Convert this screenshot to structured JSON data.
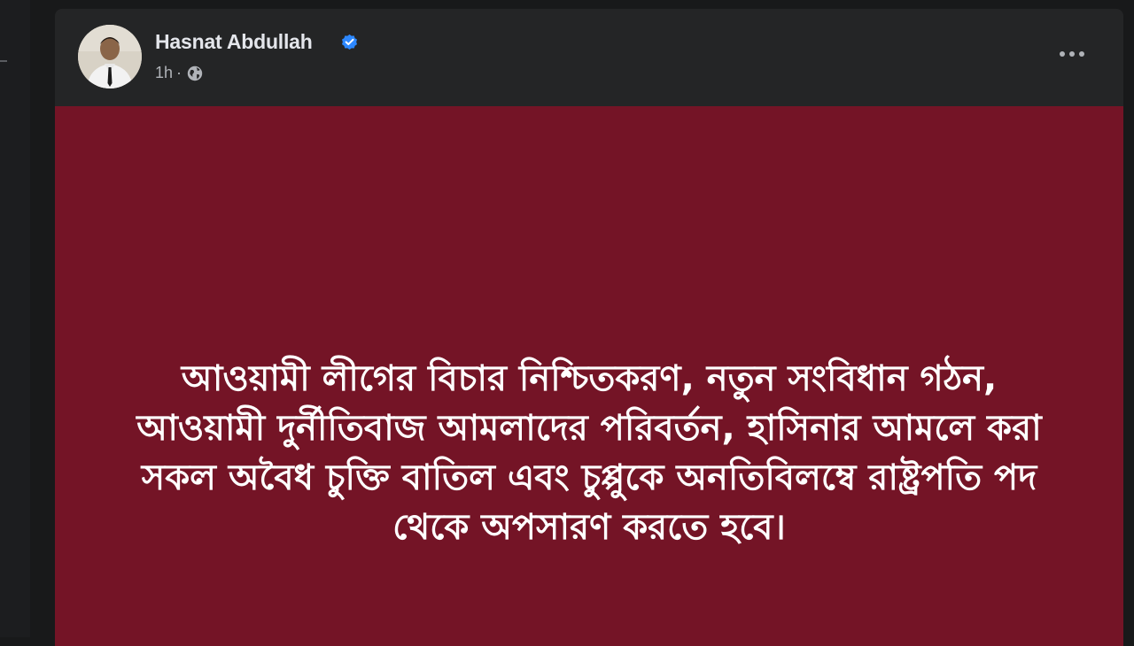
{
  "post": {
    "author_name": "Hasnat Abdullah",
    "timestamp": "1h",
    "separator": "·",
    "privacy_icon": "globe-icon",
    "verified_icon": "verified-badge-icon",
    "more_icon": "more-horizontal-icon",
    "background_color": "#741426",
    "text": "আওয়ামী লীগের বিচার নিশ্চিতকরণ, নতুন সংবিধান গঠন, আওয়ামী দুর্নীতিবাজ আমলাদের পরিবর্তন, হাসিনার আমলে করা সকল অবৈধ চুক্তি বাতিল এবং চুপ্পুকে অনতিবিলম্বে রাষ্ট্রপতি পদ থেকে অপসারণ করতে হবে।"
  },
  "colors": {
    "page_bg": "#18191a",
    "card_bg": "#242526",
    "verified_blue": "#2d88ff"
  }
}
